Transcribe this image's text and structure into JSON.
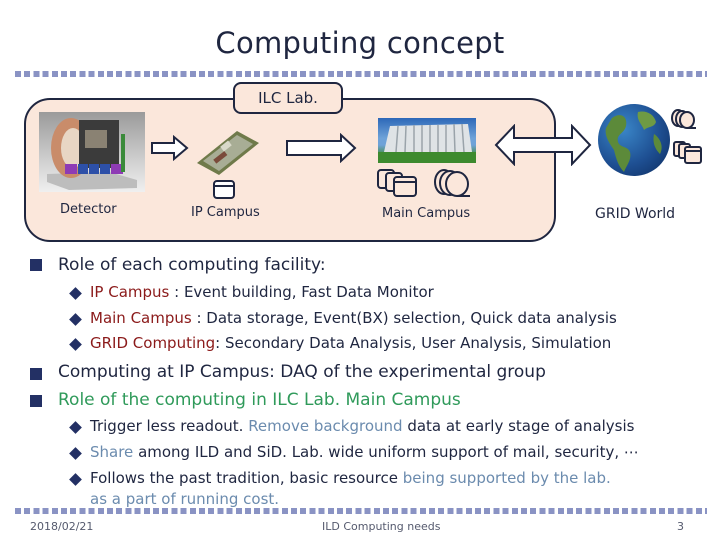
{
  "slide": {
    "title": "Computing concept",
    "diagram": {
      "lab_tag": "ILC Lab.",
      "nodes": [
        {
          "label": "Detector"
        },
        {
          "label": "IP Campus"
        },
        {
          "label": "Main Campus"
        },
        {
          "label": "GRID World"
        }
      ]
    },
    "bullets": [
      {
        "text": "Role of each computing facility:",
        "color": "#1f2640",
        "sub": [
          {
            "highlight": "IP Campus",
            "rest": " : Event building, Fast Data Monitor"
          },
          {
            "highlight": "Main Campus",
            "rest": " : Data storage, Event(BX) selection, Quick data analysis"
          },
          {
            "highlight": "GRID Computing",
            "rest": ": Secondary Data Analysis, User Analysis, Simulation"
          }
        ]
      },
      {
        "text": "Computing at IP Campus: DAQ of the experimental group",
        "color": "#1f2640"
      },
      {
        "text": "Role of the computing in ILC Lab. Main Campus",
        "color": "#2f9a5a",
        "sub2": [
          {
            "a": "Trigger less readout. ",
            "b": "Remove background",
            "c": " data at early stage of analysis"
          },
          {
            "a": "",
            "b": "Share",
            "c": " among ILD and SiD. Lab. wide uniform support of mail, security, ⋯"
          },
          {
            "a": "Follows the past tradition, basic resource ",
            "b": "being supported by the lab.",
            "c": ""
          }
        ],
        "continuation": "as a part of running cost."
      }
    ],
    "footer": {
      "date": "2018/02/21",
      "center": "ILD Computing needs",
      "page": "3"
    },
    "colors": {
      "title": "#1f2640",
      "highlight_red": "#8b1a1a",
      "highlight_green": "#2f9a5a",
      "highlight_steel": "#6b8bae",
      "lab_fill": "#fbe7db",
      "dots": "#8a93c4"
    }
  }
}
